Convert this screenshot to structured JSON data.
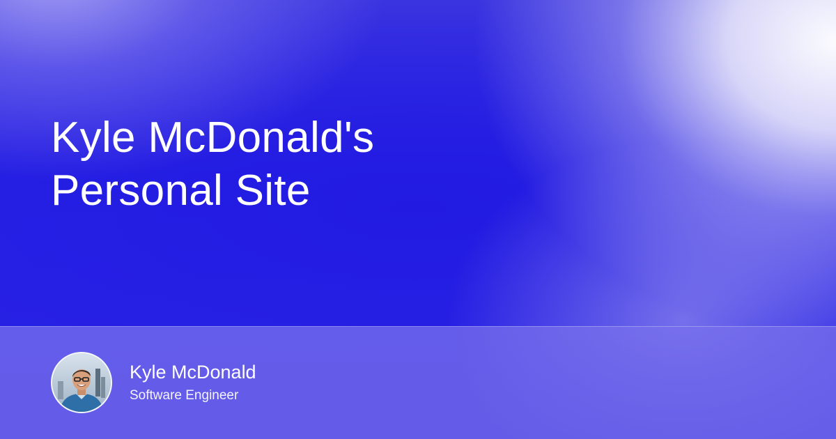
{
  "card": {
    "title_lines": [
      "Kyle McDonald's",
      "Personal Site"
    ]
  },
  "author": {
    "name": "Kyle McDonald",
    "role": "Software Engineer",
    "avatar_icon": "person-portrait-icon"
  },
  "colors": {
    "background": "#2a22e4",
    "text": "#ffffff",
    "highlight": "#f5f4fc"
  }
}
